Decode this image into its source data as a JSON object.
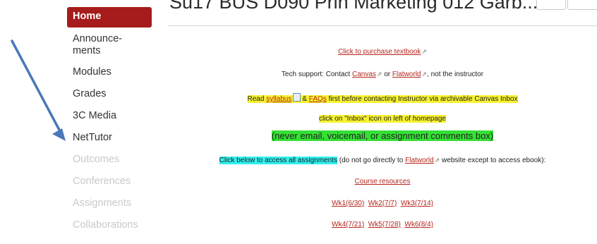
{
  "page": {
    "title": "Su17 BUS D090 Prin Marketing 012 Garb..."
  },
  "sidebar": {
    "items": [
      {
        "label": "Home"
      },
      {
        "label": "Announce-\nments"
      },
      {
        "label": "Modules"
      },
      {
        "label": "Grades"
      },
      {
        "label": "3C Media"
      },
      {
        "label": "NetTutor"
      },
      {
        "label": "Outcomes"
      },
      {
        "label": "Conferences"
      },
      {
        "label": "Assignments"
      },
      {
        "label": "Collaborations"
      }
    ]
  },
  "content": {
    "purchase_link": "Click to purchase textbook",
    "tech_prefix": "Tech support: Contact",
    "tech_canvas": "Canvas",
    "tech_or": "or",
    "tech_flatworld": "Flatworld",
    "tech_suffix": ", not the instructor",
    "read_prefix": "Read",
    "read_syllabus": "syllabus",
    "read_amp": "&",
    "read_faqs": "FAQs",
    "read_suffix": "first before contacting Instructor via archivable Canvas Inbox",
    "inbox_note": "click on \"Inbox\" icon on left of homepage",
    "never_note": "(never email, voicemail, or assignment comments box)",
    "access_highlight": "Click below to access all assignments",
    "access_mid": "(do not go directly to",
    "access_flatworld": "Flatworld",
    "access_suffix": "website except to access ebook):",
    "course_resources": "Course resources",
    "weeks_row1": [
      "Wk1(6/30)",
      "Wk2(7/7)",
      "Wk3(7/14)"
    ],
    "weeks_row2": [
      "Wk4(7/21)",
      "Wk5(7/28)",
      "Wk6(8/4)"
    ]
  },
  "colors": {
    "home_active": "#a61b1b",
    "link": "#b5261e",
    "highlight_yellow": "#f7f230",
    "highlight_green": "#35e035",
    "highlight_cyan": "#30f0f0",
    "arrow": "#4a78b8"
  },
  "icons": {
    "external": "external-link-icon",
    "document": "document-icon"
  }
}
